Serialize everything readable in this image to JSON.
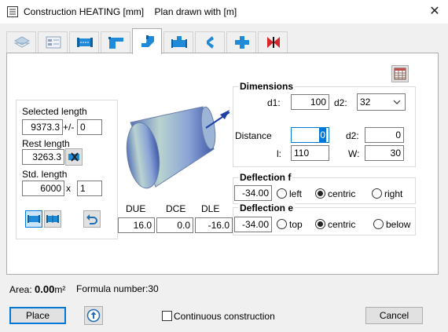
{
  "window": {
    "title": "Construction HEATING [mm]",
    "plan_info": "Plan drawn with  [m]",
    "close_glyph": "✕"
  },
  "tabs": [
    {
      "icon": "layer-icon",
      "active": false
    },
    {
      "icon": "properties-icon",
      "active": false
    },
    {
      "icon": "straight-duct-icon",
      "active": false
    },
    {
      "icon": "bend-icon",
      "active": false
    },
    {
      "icon": "offset-bend-icon",
      "active": true
    },
    {
      "icon": "tee-icon",
      "active": false
    },
    {
      "icon": "transition-icon",
      "active": false
    },
    {
      "icon": "cross-icon",
      "active": false
    },
    {
      "icon": "damper-icon",
      "active": false
    }
  ],
  "lengths": {
    "selected_label": "Selected length",
    "selected_value": "9373.3",
    "plusminus": "+/-",
    "tolerance_value": "0",
    "rest_label": "Rest length",
    "rest_value": "3263.3",
    "std_label": "Std. length",
    "std_value": "6000",
    "times": "x",
    "count_value": "1"
  },
  "offsets": {
    "due_label": "DUE",
    "dce_label": "DCE",
    "dle_label": "DLE",
    "due_value": "16.0",
    "dce_value": "0.0",
    "dle_value": "-16.0"
  },
  "dimensions": {
    "header": "Dimensions",
    "d1_label": "d1:",
    "d1_value": "100",
    "d2_label": "d2:",
    "d2_select": "32",
    "distance_label": "Distance",
    "distance_value": "0",
    "d2b_label": "d2:",
    "d2b_value": "0",
    "l_label": "l:",
    "l_value": "110",
    "w_label": "W:",
    "w_value": "30"
  },
  "deflection_f": {
    "header": "Deflection f",
    "value": "-34.00",
    "options": [
      "left",
      "centric",
      "right"
    ],
    "selected": "centric"
  },
  "deflection_e": {
    "header": "Deflection e",
    "value": "-34.00",
    "options": [
      "top",
      "centric",
      "below"
    ],
    "selected": "centric"
  },
  "status": {
    "area_label": "Area:",
    "area_value": "0.00",
    "area_unit": "m²",
    "formula_label": "Formula number:30"
  },
  "footer": {
    "place_label": "Place",
    "continuous_label": "Continuous construction",
    "continuous_checked": false,
    "cancel_label": "Cancel"
  }
}
